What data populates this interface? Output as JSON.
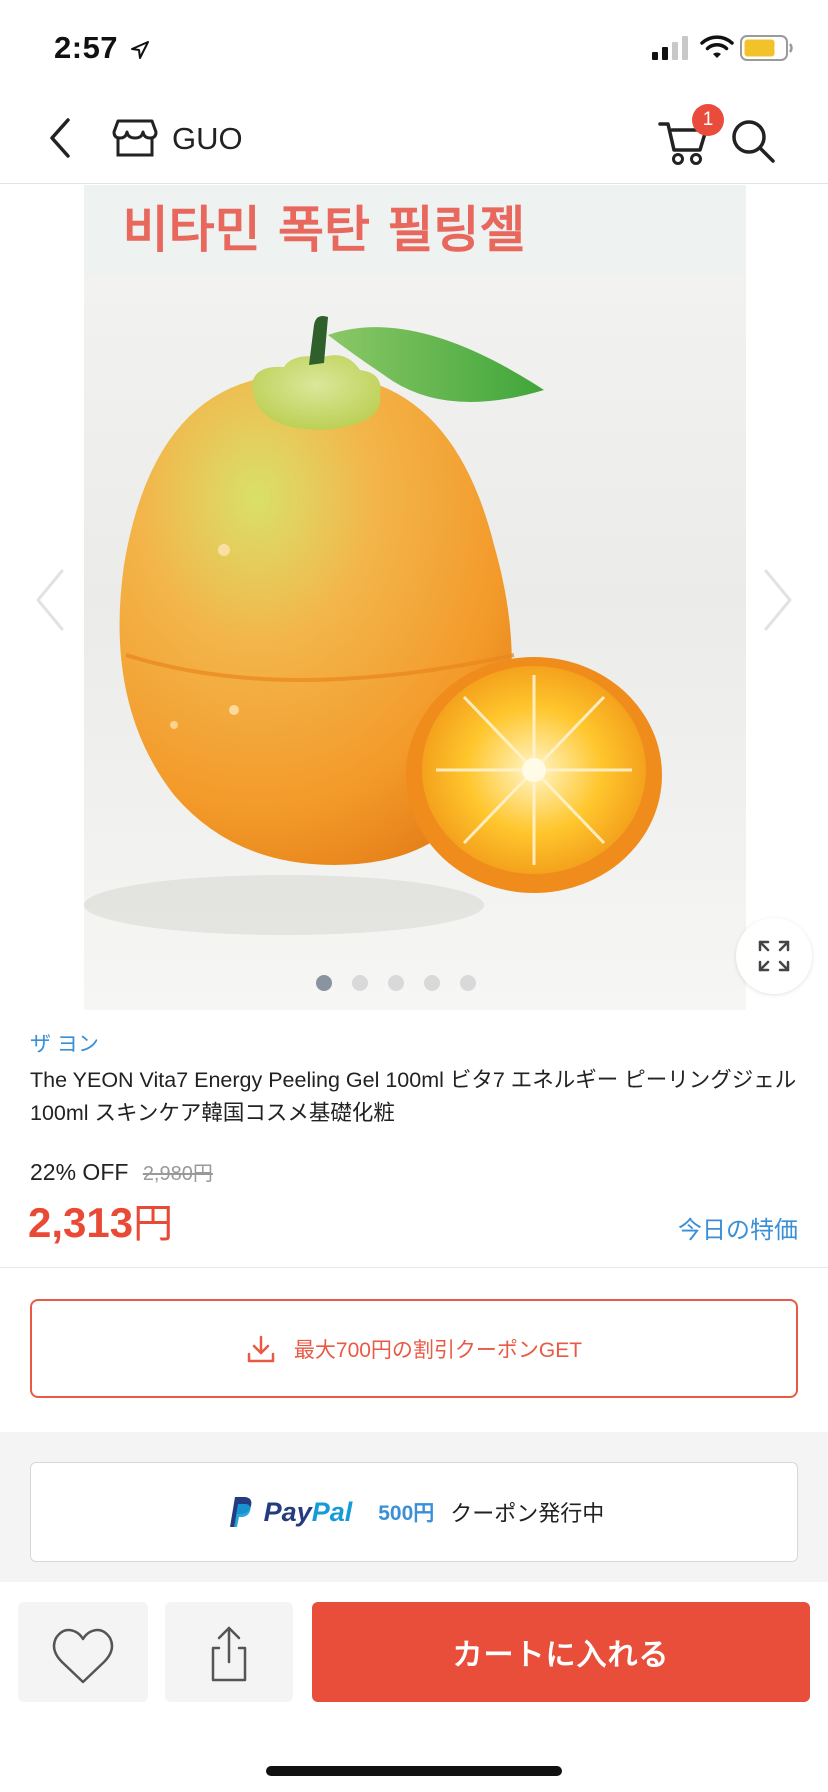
{
  "status_bar": {
    "time": "2:57"
  },
  "nav": {
    "store_name": "GUO",
    "cart_count": "1"
  },
  "gallery": {
    "banner_text": "비타민 폭탄 필링젤",
    "image_count": 5,
    "active_index": 0
  },
  "product": {
    "brand": "ザ ヨン",
    "title": "The YEON Vita7 Energy Peeling Gel 100ml ビタ7 エネルギー ピーリングジェル 100ml スキンケア韓国コスメ基礎化粧",
    "discount": "22% OFF",
    "original_price": "2,980円",
    "price_number": "2,313",
    "price_unit": "円",
    "today_deal": "今日の特価"
  },
  "coupon": {
    "label": "最大700円の割引クーポンGET"
  },
  "paypal": {
    "pay": "Pay",
    "pal": "Pal",
    "amount": "500円",
    "text": "クーポン発行中"
  },
  "bottom": {
    "add_to_cart": "カートに入れる"
  },
  "colors": {
    "accent": "#e94e3b",
    "link": "#3a8fd6",
    "paypal_dark": "#253b80",
    "paypal_light": "#179bd7"
  }
}
